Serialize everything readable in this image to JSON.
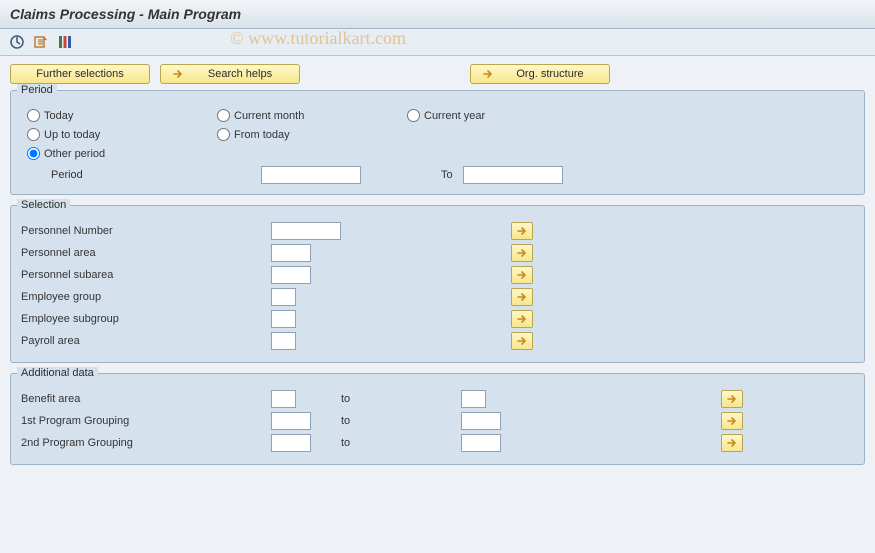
{
  "title": "Claims Processing - Main Program",
  "watermark": "© www.tutorialkart.com",
  "toolbar": {
    "further_selections": "Further selections",
    "search_helps": "Search helps",
    "org_structure": "Org. structure"
  },
  "period": {
    "legend": "Period",
    "radios": {
      "today": "Today",
      "current_month": "Current month",
      "current_year": "Current year",
      "up_to_today": "Up to today",
      "from_today": "From today",
      "other_period": "Other period"
    },
    "selected": "other_period",
    "period_label": "Period",
    "to_label": "To",
    "period_from": "",
    "period_to": ""
  },
  "selection": {
    "legend": "Selection",
    "rows": [
      {
        "label": "Personnel Number",
        "value": "",
        "width": "w70"
      },
      {
        "label": "Personnel area",
        "value": "",
        "width": "w40"
      },
      {
        "label": "Personnel subarea",
        "value": "",
        "width": "w40"
      },
      {
        "label": "Employee group",
        "value": "",
        "width": "w25"
      },
      {
        "label": "Employee subgroup",
        "value": "",
        "width": "w25"
      },
      {
        "label": "Payroll area",
        "value": "",
        "width": "w25"
      }
    ]
  },
  "additional": {
    "legend": "Additional data",
    "to_label": "to",
    "rows": [
      {
        "label": "Benefit area",
        "from": "",
        "to": ""
      },
      {
        "label": "1st Program Grouping",
        "from": "",
        "to": ""
      },
      {
        "label": "2nd Program Grouping",
        "from": "",
        "to": ""
      }
    ]
  }
}
